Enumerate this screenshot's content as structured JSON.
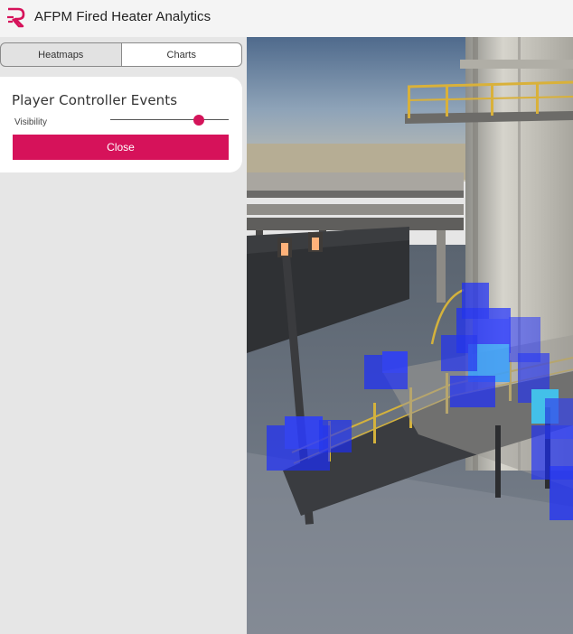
{
  "app": {
    "title": "AFPM Fired Heater Analytics"
  },
  "tabs": [
    {
      "label": "Heatmaps",
      "selected": true
    },
    {
      "label": "Charts",
      "selected": false
    }
  ],
  "panel": {
    "title": "Player Controller Events",
    "visibility_label": "Visibility",
    "visibility_value": 0.75,
    "close_label": "Close"
  },
  "colors": {
    "accent": "#d6125a",
    "heatmap_low": "#1a2cff",
    "heatmap_high": "#38c8ff"
  }
}
